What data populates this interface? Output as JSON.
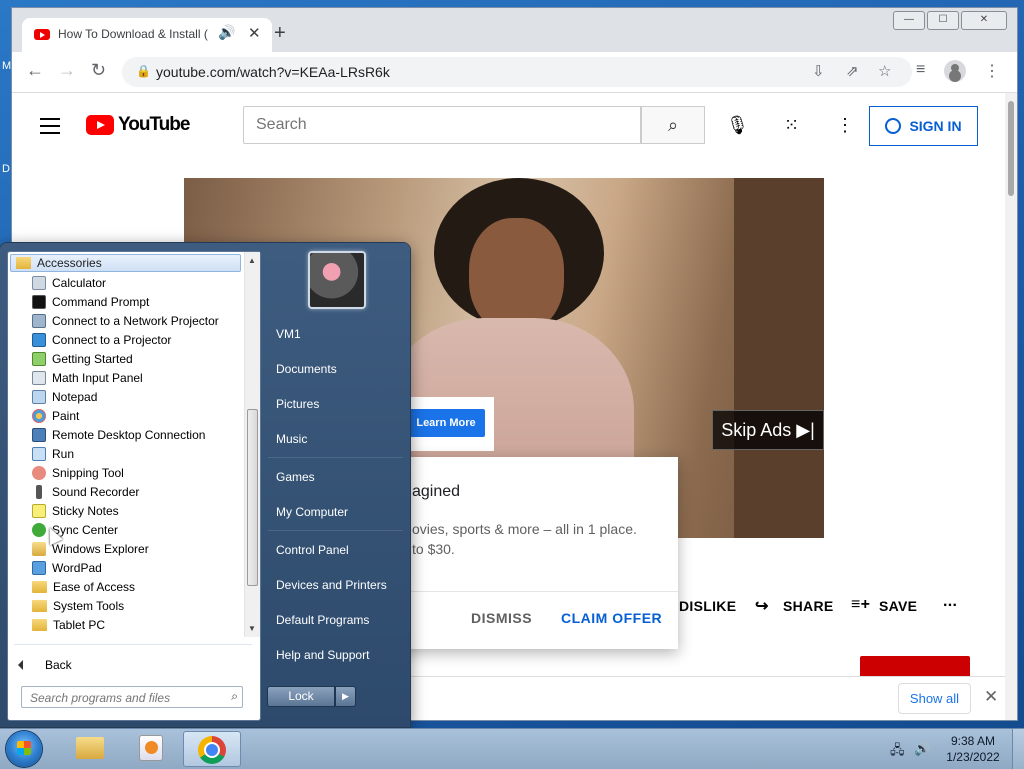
{
  "desktop": {
    "text1": "M",
    "text2": "D"
  },
  "browser": {
    "tab_title": "How To Download & Install (",
    "url": "youtube.com/watch?v=KEAa-LRsR6k",
    "new_tab_label": "+",
    "window_buttons": [
      "—",
      "☐",
      "✕"
    ]
  },
  "youtube": {
    "logo_text": "YouTube",
    "search_placeholder": "Search",
    "sign_in_label": "SIGN IN",
    "skip_ads_label": "Skip Ads ▶|",
    "learn_more_label": "Learn More",
    "promo": {
      "title": "agined",
      "body_line1": "ovies, sports & more – all in 1 place.",
      "body_line2": "to $30.",
      "dismiss_label": "DISMISS",
      "claim_label": "CLAIM OFFER"
    },
    "actions": {
      "dislike_label": "DISLIKE",
      "share_label": "SHARE",
      "save_label": "SAVE",
      "more_label": "..."
    },
    "show_all_label": "Show all"
  },
  "start_menu": {
    "folder": "Accessories",
    "programs": [
      "Calculator",
      "Command Prompt",
      "Connect to a Network Projector",
      "Connect to a Projector",
      "Getting Started",
      "Math Input Panel",
      "Notepad",
      "Paint",
      "Remote Desktop Connection",
      "Run",
      "Snipping Tool",
      "Sound Recorder",
      "Sticky Notes",
      "Sync Center",
      "Windows Explorer",
      "WordPad",
      "Ease of Access",
      "System Tools",
      "Tablet PC"
    ],
    "back_label": "Back",
    "search_placeholder": "Search programs and files",
    "right_links": [
      "VM1",
      "Documents",
      "Pictures",
      "Music",
      "Games",
      "My Computer",
      "Control Panel",
      "Devices and Printers",
      "Default Programs",
      "Help and Support"
    ],
    "lock_label": "Lock",
    "lock_arrow": "▶"
  },
  "taskbar": {
    "clock_time": "9:38 AM",
    "clock_date": "1/23/2022"
  }
}
